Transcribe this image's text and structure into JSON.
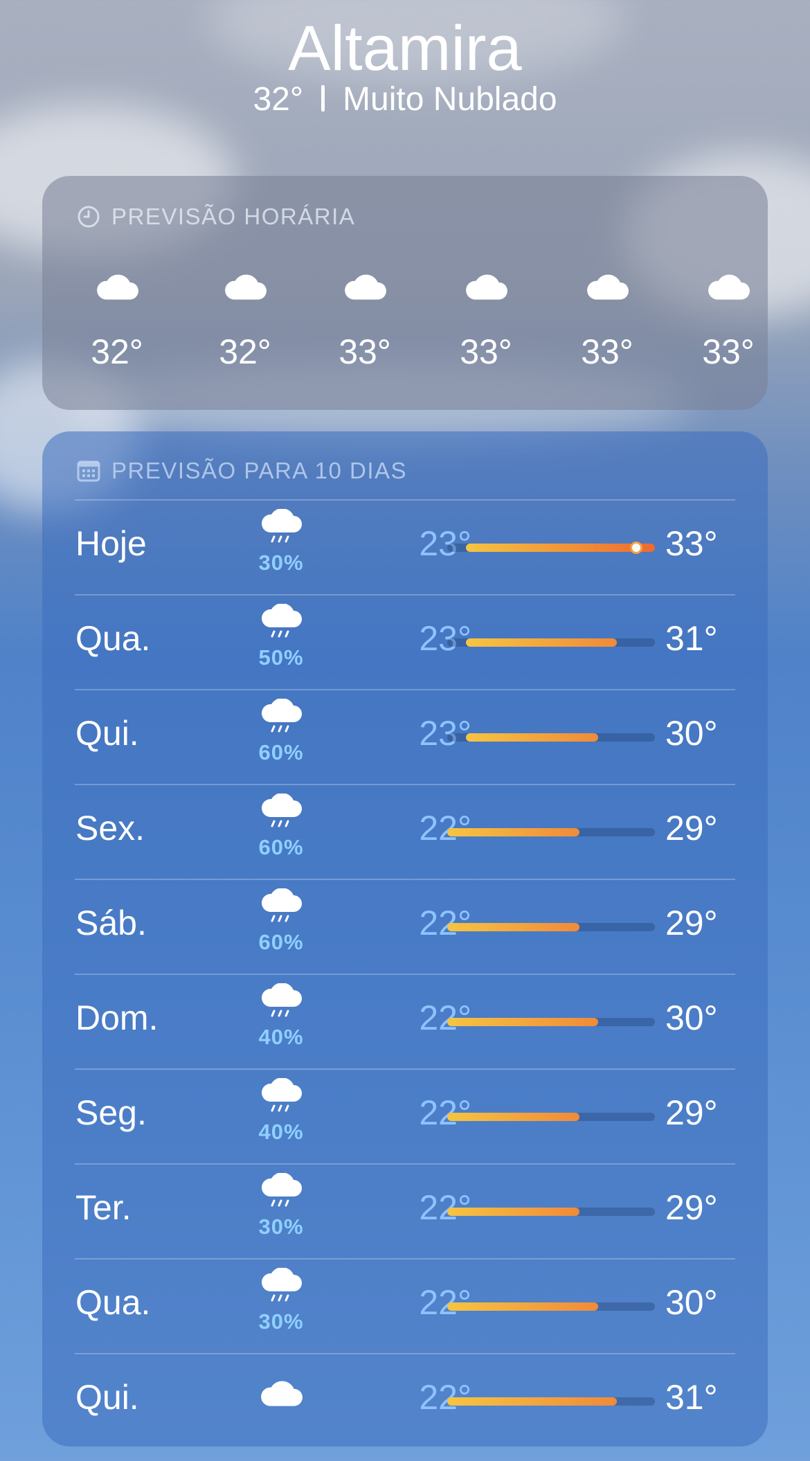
{
  "location": {
    "city": "Altamira",
    "current_temp": "32°",
    "condition": "Muito Nublado"
  },
  "hourly": {
    "title": "PREVISÃO HORÁRIA",
    "header_icon": "clock-icon",
    "items": [
      {
        "icon": "cloud-icon",
        "temp": "32°"
      },
      {
        "icon": "cloud-icon",
        "temp": "32°"
      },
      {
        "icon": "cloud-icon",
        "temp": "33°"
      },
      {
        "icon": "cloud-icon",
        "temp": "33°"
      },
      {
        "icon": "cloud-icon",
        "temp": "33°"
      },
      {
        "icon": "cloud-icon",
        "temp": "33°"
      }
    ]
  },
  "daily": {
    "title": "PREVISÃO PARA 10 DIAS",
    "header_icon": "calendar-icon",
    "range_min": 22,
    "range_max": 33,
    "days": [
      {
        "day": "Hoje",
        "icon": "cloud-rain-icon",
        "precip": "30%",
        "low": "23°",
        "high": "33°",
        "low_v": 23,
        "high_v": 33,
        "current_v": 32
      },
      {
        "day": "Qua.",
        "icon": "cloud-rain-icon",
        "precip": "50%",
        "low": "23°",
        "high": "31°",
        "low_v": 23,
        "high_v": 31
      },
      {
        "day": "Qui.",
        "icon": "cloud-rain-icon",
        "precip": "60%",
        "low": "23°",
        "high": "30°",
        "low_v": 23,
        "high_v": 30
      },
      {
        "day": "Sex.",
        "icon": "cloud-rain-icon",
        "precip": "60%",
        "low": "22°",
        "high": "29°",
        "low_v": 22,
        "high_v": 29
      },
      {
        "day": "Sáb.",
        "icon": "cloud-rain-icon",
        "precip": "60%",
        "low": "22°",
        "high": "29°",
        "low_v": 22,
        "high_v": 29
      },
      {
        "day": "Dom.",
        "icon": "cloud-rain-icon",
        "precip": "40%",
        "low": "22°",
        "high": "30°",
        "low_v": 22,
        "high_v": 30
      },
      {
        "day": "Seg.",
        "icon": "cloud-rain-icon",
        "precip": "40%",
        "low": "22°",
        "high": "29°",
        "low_v": 22,
        "high_v": 29
      },
      {
        "day": "Ter.",
        "icon": "cloud-rain-icon",
        "precip": "30%",
        "low": "22°",
        "high": "29°",
        "low_v": 22,
        "high_v": 29
      },
      {
        "day": "Qua.",
        "icon": "cloud-rain-icon",
        "precip": "30%",
        "low": "22°",
        "high": "30°",
        "low_v": 22,
        "high_v": 30
      },
      {
        "day": "Qui.",
        "icon": "cloud-icon",
        "precip": "",
        "low": "22°",
        "high": "31°",
        "low_v": 22,
        "high_v": 31
      }
    ]
  },
  "colors": {
    "bar_low": "#f5c542",
    "bar_high": "#f08a3a",
    "bar_hot": "#ee6a2e",
    "precip_text": "#8fd0ff",
    "low_temp_text": "#8ec3ff"
  }
}
